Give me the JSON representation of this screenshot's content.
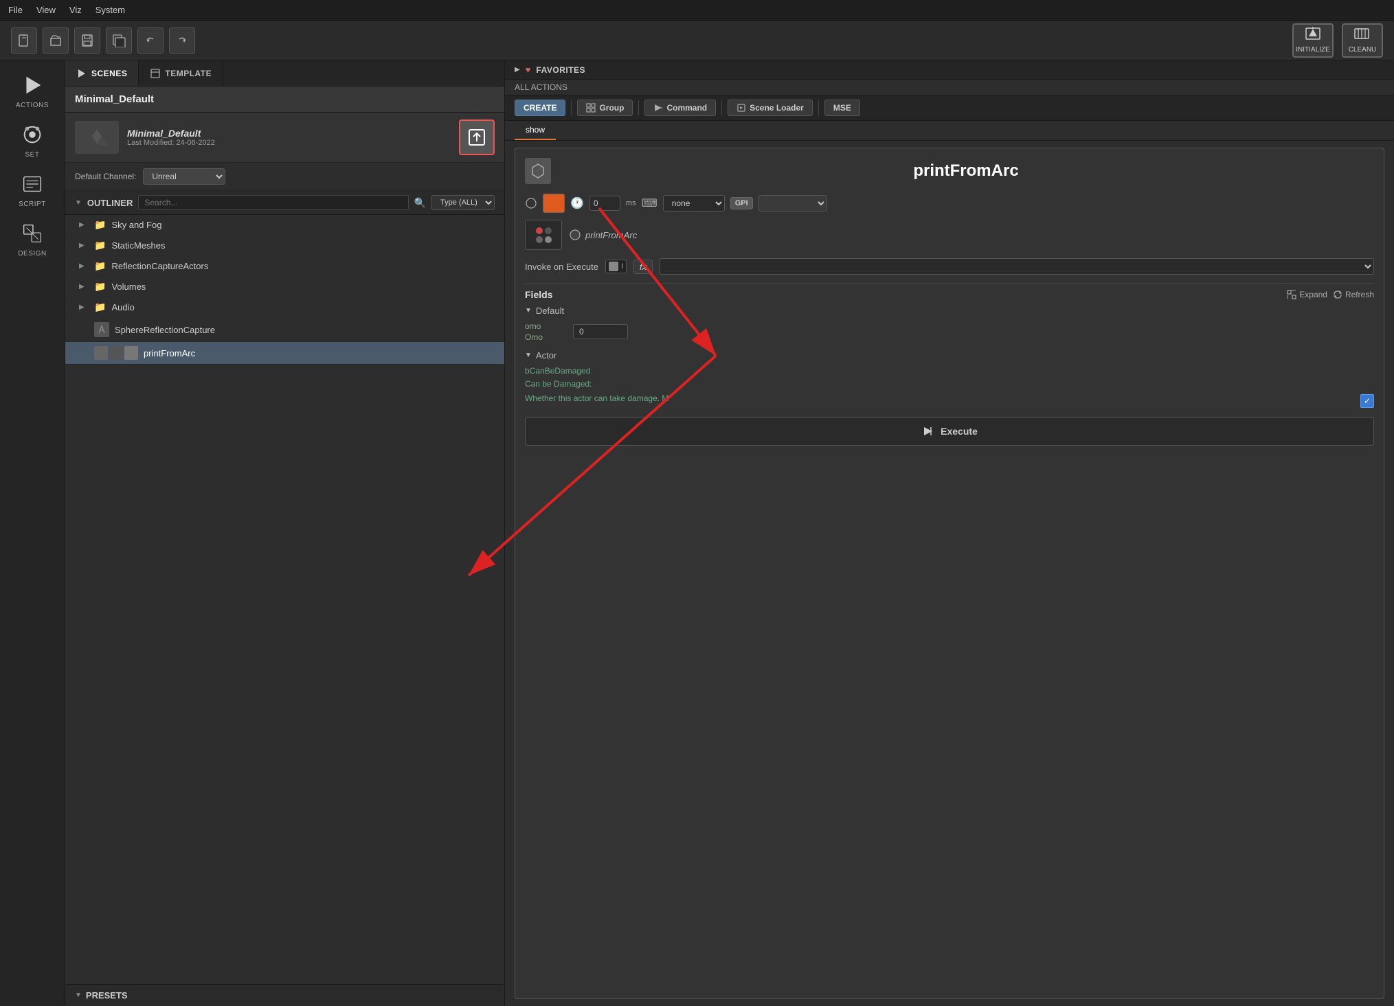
{
  "menubar": {
    "items": [
      "File",
      "View",
      "Viz",
      "System"
    ]
  },
  "toolbar": {
    "buttons": [
      "new",
      "open",
      "save",
      "save-as",
      "undo",
      "redo"
    ],
    "right": {
      "initialize_label": "INITIALIZE",
      "cleanup_label": "CLEANU"
    }
  },
  "icon_sidebar": {
    "items": [
      {
        "id": "actions",
        "label": "ACTIONS"
      },
      {
        "id": "set",
        "label": "SET"
      },
      {
        "id": "script",
        "label": "SCRIPT"
      },
      {
        "id": "design",
        "label": "DESIGN"
      }
    ]
  },
  "scenes_panel": {
    "tabs": [
      {
        "id": "scenes",
        "label": "SCENES",
        "active": true
      },
      {
        "id": "template",
        "label": "TEMPLATE"
      }
    ],
    "scene_header": {
      "name": "Minimal_Default"
    },
    "scene_item": {
      "title": "Minimal_Default",
      "subtitle": "Last Modified: 24-06-2022"
    },
    "channel": {
      "label": "Default Channel:",
      "value": "Unreal"
    },
    "outliner": {
      "title": "OUTLINER",
      "search_placeholder": "Search...",
      "type_filter": "Type (ALL)",
      "items": [
        {
          "name": "Sky and Fog",
          "type": "folder",
          "expanded": false
        },
        {
          "name": "StaticMeshes",
          "type": "folder",
          "expanded": false
        },
        {
          "name": "ReflectionCaptureActors",
          "type": "folder",
          "expanded": false
        },
        {
          "name": "Volumes",
          "type": "folder",
          "expanded": false
        },
        {
          "name": "Audio",
          "type": "folder",
          "expanded": false
        },
        {
          "name": "SphereReflectionCapture",
          "type": "item"
        },
        {
          "name": "printFromArc",
          "type": "item-selected"
        }
      ]
    },
    "presets": {
      "title": "PRESETS"
    }
  },
  "actions_panel": {
    "favorites": {
      "label": "FAVORITES"
    },
    "all_actions_label": "ALL ACTIONS",
    "create_toolbar": {
      "buttons": [
        "CREATE",
        "Group",
        "Command",
        "Scene Loader",
        "MSE"
      ]
    },
    "show_tab": "show",
    "command": {
      "title": "printFromArc",
      "color": "#e05a20",
      "time_value": "0",
      "time_unit": "ms",
      "gpi_value": "none",
      "gpi_label": "GPI",
      "invoke_label": "Invoke on Execute",
      "fx_label": "fx",
      "action_name": "printFromArc",
      "fields": {
        "title": "Fields",
        "expand_label": "Expand",
        "refresh_label": "Refresh",
        "sections": [
          {
            "title": "Default",
            "fields": [
              {
                "id": "omo",
                "label": "omo",
                "main_label": "Omo",
                "value": "0"
              }
            ]
          },
          {
            "title": "Actor",
            "fields": [
              {
                "id": "bCanBeDamaged",
                "label": "bCanBeDamaged",
                "main_label": "Can be Damaged:",
                "desc": "Whether this actor can take damage. M",
                "checked": true
              }
            ]
          }
        ]
      },
      "execute_label": "Execute"
    }
  }
}
